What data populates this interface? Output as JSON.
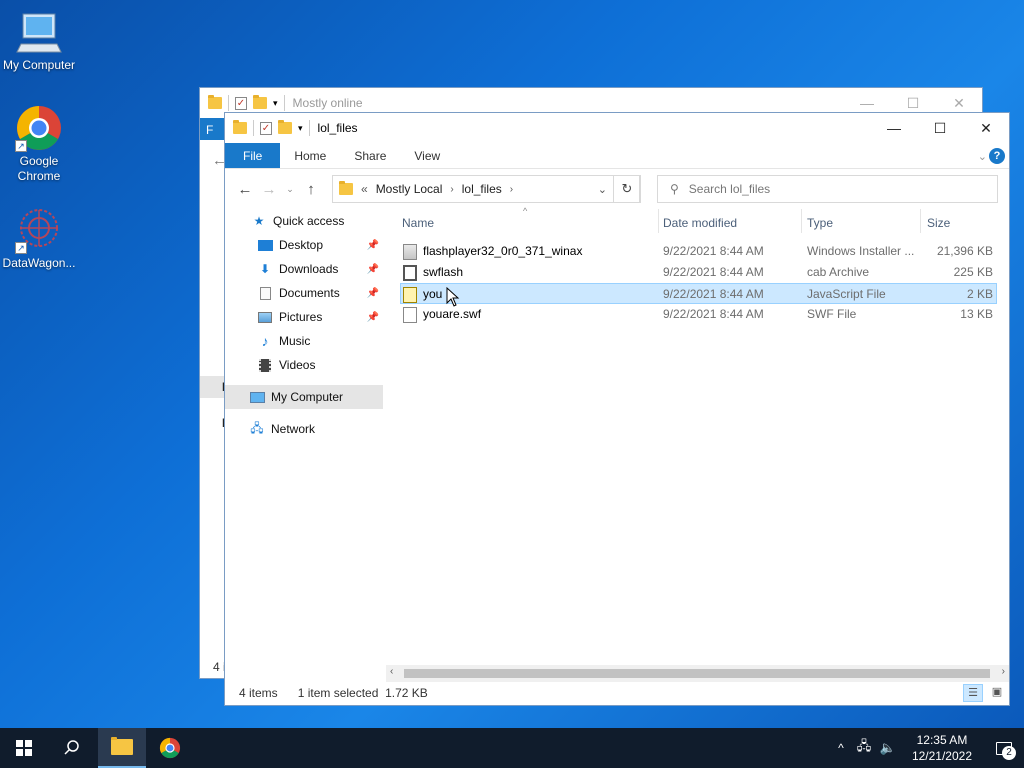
{
  "desktop": {
    "icons": [
      {
        "label": "My Computer"
      },
      {
        "label": "Google Chrome"
      },
      {
        "label": "DataWagon..."
      }
    ]
  },
  "back_window": {
    "title": "Mostly online",
    "ribbon_file_partial": "F",
    "nav_partial_1": "l",
    "nav_partial_2": "l",
    "status_partial": "4 i"
  },
  "front_window": {
    "title": "lol_files",
    "ribbon_tabs": [
      "File",
      "Home",
      "Share",
      "View"
    ],
    "address": {
      "overflow": "«",
      "crumbs": [
        "Mostly Local",
        "lol_files"
      ]
    },
    "search_placeholder": "Search lol_files",
    "nav_pane": {
      "quick_access": "Quick access",
      "items": [
        {
          "label": "Desktop",
          "icon": "desktop-icon",
          "pinned": true
        },
        {
          "label": "Downloads",
          "icon": "downloads-icon",
          "pinned": true
        },
        {
          "label": "Documents",
          "icon": "documents-icon",
          "pinned": true
        },
        {
          "label": "Pictures",
          "icon": "pictures-icon",
          "pinned": true
        },
        {
          "label": "Music",
          "icon": "music-icon",
          "pinned": false
        },
        {
          "label": "Videos",
          "icon": "videos-icon",
          "pinned": false
        }
      ],
      "my_computer": "My Computer",
      "network": "Network"
    },
    "columns": [
      "Name",
      "Date modified",
      "Type",
      "Size"
    ],
    "files": [
      {
        "name": "flashplayer32_0r0_371_winax",
        "date": "9/22/2021 8:44 AM",
        "type": "Windows Installer ...",
        "size": "21,396 KB",
        "icon": "installer-icon",
        "selected": false
      },
      {
        "name": "swflash",
        "date": "9/22/2021 8:44 AM",
        "type": "cab Archive",
        "size": "225 KB",
        "icon": "cab-archive-icon",
        "selected": false
      },
      {
        "name": "you",
        "date": "9/22/2021 8:44 AM",
        "type": "JavaScript File",
        "size": "2 KB",
        "icon": "javascript-file-icon",
        "selected": true
      },
      {
        "name": "youare.swf",
        "date": "9/22/2021 8:44 AM",
        "type": "SWF File",
        "size": "13 KB",
        "icon": "blank-file-icon",
        "selected": false
      }
    ],
    "status": {
      "items": "4 items",
      "selected": "1 item selected  1.72 KB"
    }
  },
  "taskbar": {
    "time": "12:35 AM",
    "date": "12/21/2022",
    "notifications_count": "2"
  },
  "colors": {
    "accent": "#1979ca",
    "selection": "#cce8ff",
    "taskbar": "#101c2c"
  }
}
